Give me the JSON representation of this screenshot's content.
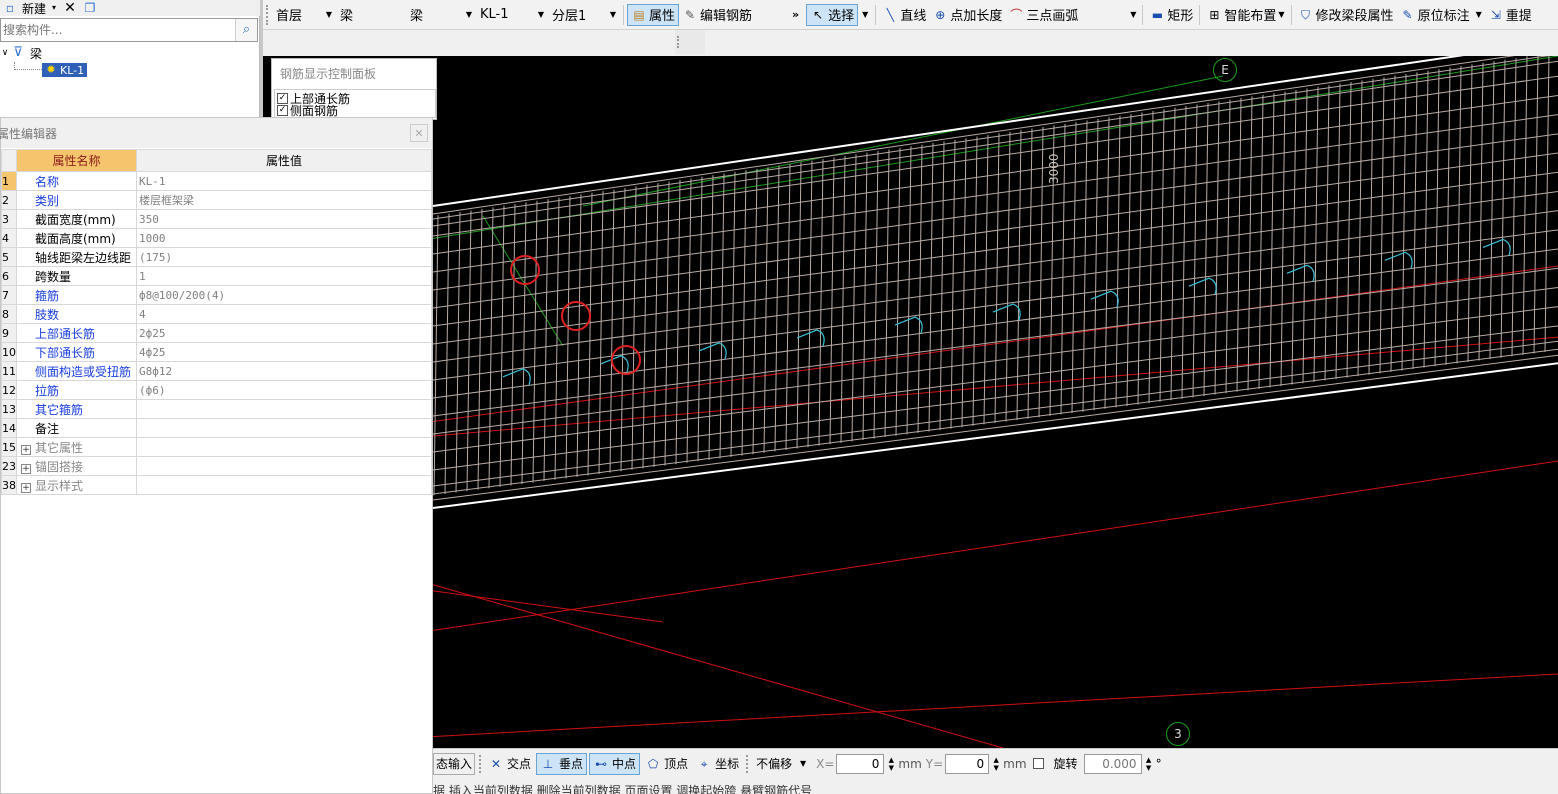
{
  "left_toolbar": {
    "new_label": "新建"
  },
  "search": {
    "placeholder": "搜索构件..."
  },
  "tree": {
    "root": "梁",
    "child": "KL-1"
  },
  "toolbar": {
    "floor": "首层",
    "category": "梁",
    "subcategory": "梁",
    "component": "KL-1",
    "layer": "分层1",
    "property": "属性",
    "edit_rebar": "编辑钢筋",
    "more": "»",
    "select": "选择",
    "line": "直线",
    "point_length": "点加长度",
    "three_point_arc": "三点画弧",
    "rect": "矩形",
    "smart_layout": "智能布置",
    "modify_segment": "修改梁段属性",
    "original_mark": "原位标注",
    "re_extract": "重提"
  },
  "control_panel": {
    "title": "钢筋显示控制面板",
    "items": [
      "上部通长筋",
      "侧面钢筋"
    ]
  },
  "prop_editor": {
    "title": "属性编辑器",
    "header_name": "属性名称",
    "header_value": "属性值",
    "rows": [
      {
        "num": "1",
        "name": "名称",
        "value": "KL-1",
        "blue": true
      },
      {
        "num": "2",
        "name": "类别",
        "value": "楼层框架梁",
        "blue": true
      },
      {
        "num": "3",
        "name": "截面宽度(mm)",
        "value": "350",
        "blue": false
      },
      {
        "num": "4",
        "name": "截面高度(mm)",
        "value": "1000",
        "blue": false
      },
      {
        "num": "5",
        "name": "轴线距梁左边线距",
        "value": "(175)",
        "blue": false
      },
      {
        "num": "6",
        "name": "跨数量",
        "value": "1",
        "blue": false
      },
      {
        "num": "7",
        "name": "箍筋",
        "value": "ф8@100/200(4)",
        "blue": true
      },
      {
        "num": "8",
        "name": "肢数",
        "value": "4",
        "blue": true
      },
      {
        "num": "9",
        "name": "上部通长筋",
        "value": "2ф25",
        "blue": true
      },
      {
        "num": "10",
        "name": "下部通长筋",
        "value": "4ф25",
        "blue": true
      },
      {
        "num": "11",
        "name": "侧面构造或受扭筋",
        "value": "G8ф12",
        "blue": true
      },
      {
        "num": "12",
        "name": "拉筋",
        "value": "(ф6)",
        "blue": true
      },
      {
        "num": "13",
        "name": "其它箍筋",
        "value": "",
        "blue": true
      },
      {
        "num": "14",
        "name": "备注",
        "value": "",
        "blue": false
      },
      {
        "num": "15",
        "name": "其它属性",
        "value": "",
        "blue": false,
        "group": true
      },
      {
        "num": "23",
        "name": "锚固搭接",
        "value": "",
        "blue": false,
        "group": true
      },
      {
        "num": "38",
        "name": "显示样式",
        "value": "",
        "blue": false,
        "group": true
      }
    ]
  },
  "viewport": {
    "axis_top": "E",
    "axis_bottom": "3",
    "dimension": "3000"
  },
  "status": {
    "dynamic_input": "态输入",
    "intersection": "交点",
    "perpendicular": "垂点",
    "midpoint": "中点",
    "vertex": "顶点",
    "coordinate": "坐标",
    "no_offset": "不偏移",
    "x_label": "X=",
    "x_value": "0",
    "mm1": "mm",
    "y_label": "Y=",
    "y_value": "0",
    "mm2": "mm",
    "rotate": "旋转",
    "rotate_value": "0.000",
    "degree": "°"
  },
  "bottom_bar": {
    "text": "据  插入当前列数据  删除当前列数据  页面设置  调换起始跨  悬臂钢筋代号"
  }
}
